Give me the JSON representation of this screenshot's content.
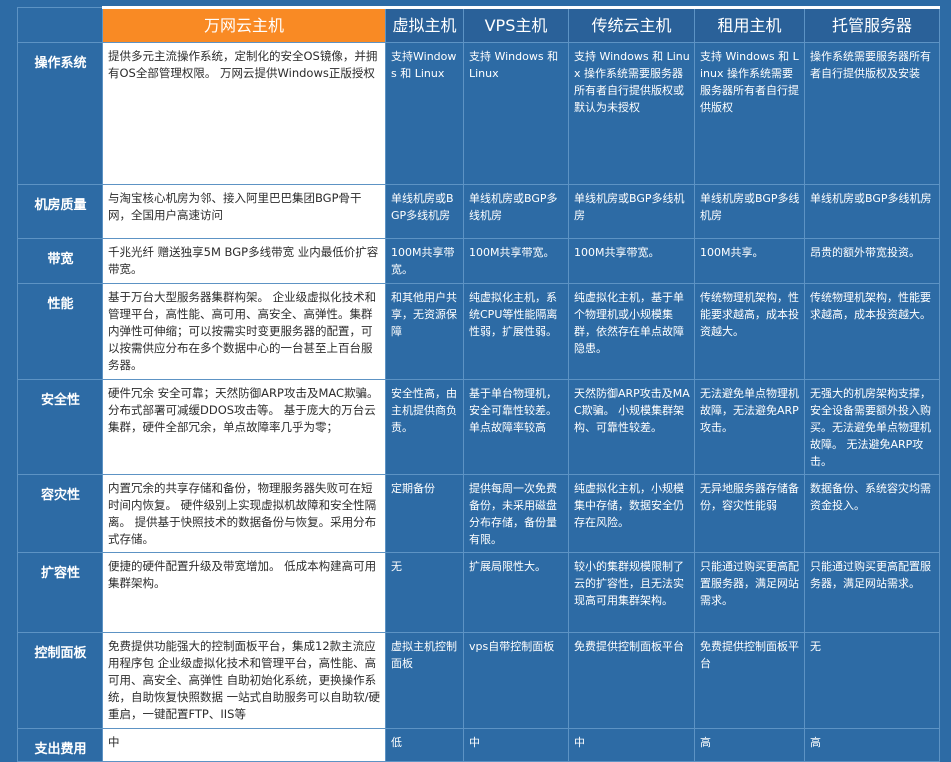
{
  "headers": [
    "",
    "万网云主机",
    "虚拟主机",
    "VPS主机",
    "传统云主机",
    "租用主机",
    "托管服务器"
  ],
  "rows": [
    {
      "label": "操作系统",
      "cells": [
        "提供多元主流操作系统，定制化的安全OS镜像，并拥有OS全部管理权限。 万网云提供Windows正版授权",
        "支持Windows 和 Linux",
        "支持 Windows 和 Linux",
        "支持 Windows 和 Linux 操作系统需要服务器所有者自行提供版权或默认为未授权",
        "支持 Windows 和 Linux 操作系统需要服务器所有者自行提供版权",
        "操作系统需要服务器所有者自行提供版权及安装"
      ]
    },
    {
      "label": "机房质量",
      "cells": [
        "与淘宝核心机房为邻、接入阿里巴巴集团BGP骨干网，全国用户高速访问",
        "单线机房或BGP多线机房",
        "单线机房或BGP多线机房",
        "单线机房或BGP多线机房",
        "单线机房或BGP多线机房",
        "单线机房或BGP多线机房"
      ]
    },
    {
      "label": "带宽",
      "cells": [
        "千兆光纤 赠送独享5M BGP多线带宽 业内最低价扩容带宽。",
        "100M共享带宽。",
        "100M共享带宽。",
        "100M共享带宽。",
        "100M共享。",
        "昂贵的额外带宽投资。"
      ]
    },
    {
      "label": "性能",
      "cells": [
        "基于万台大型服务器集群构架。 企业级虚拟化技术和管理平台，高性能、高可用、高安全、高弹性。集群内弹性可伸缩；可以按需实时变更服务器的配置，可以按需供应分布在多个数据中心的一台甚至上百台服务器。",
        "和其他用户共享，无资源保障",
        "纯虚拟化主机，系统CPU等性能隔离性弱，扩展性弱。",
        "纯虚拟化主机，基于单个物理机或小规模集群，依然存在单点故障隐患。",
        "传统物理机架构，性能要求越高，成本投资越大。",
        "传统物理机架构，性能要求越高，成本投资越大。"
      ]
    },
    {
      "label": "安全性",
      "cells": [
        "硬件冗余 安全可靠；天然防御ARP攻击及MAC欺骗。分布式部署可减缓DDOS攻击等。 基于庞大的万台云集群，硬件全部冗余，单点故障率几乎为零；",
        "安全性高，由主机提供商负责。",
        "基于单台物理机，安全可靠性较差。单点故障率较高",
        "天然防御ARP攻击及MAC欺骗。 小规模集群架构、可靠性较差。",
        "无法避免单点物理机故障，无法避免ARP攻击。",
        "无强大的机房架构支撑，安全设备需要额外投入购买。无法避免单点物理机故障。 无法避免ARP攻击。"
      ]
    },
    {
      "label": "容灾性",
      "cells": [
        "内置冗余的共享存储和备份，物理服务器失败可在短时间内恢复。 硬件级别上实现虚拟机故障和安全性隔离。 提供基于快照技术的数据备份与恢复。采用分布式存储。",
        "定期备份",
        "提供每周一次免费备份，未采用磁盘分布存储，备份量有限。",
        "纯虚拟化主机，小规模集中存储，数据安全仍存在风险。",
        "无异地服务器存储备份，容灾性能弱",
        "数据备份、系统容灾均需资金投入。"
      ]
    },
    {
      "label": "扩容性",
      "cells": [
        "便捷的硬件配置升级及带宽增加。 低成本构建高可用集群架构。",
        "无",
        "扩展局限性大。",
        "较小的集群规模限制了云的扩容性，且无法实现高可用集群架构。",
        "只能通过购买更高配置服务器，满足网站需求。",
        "只能通过购买更高配置服务器，满足网站需求。"
      ]
    },
    {
      "label": "控制面板",
      "cells": [
        "免费提供功能强大的控制面板平台，集成12款主流应用程序包 企业级虚拟化技术和管理平台，高性能、高可用、高安全、高弹性 自助初始化系统，更换操作系统，自助恢复快照数据 一站式自助服务可以自助软/硬重启，一键配置FTP、IIS等",
        "虚拟主机控制面板",
        "vps自带控制面板",
        "免费提供控制面板平台",
        "免费提供控制面板平台",
        "无"
      ]
    },
    {
      "label": "支出费用",
      "cells": [
        "中",
        "低",
        "中",
        "中",
        "高",
        "高"
      ]
    }
  ],
  "colors": {
    "background": "#2d6ba5",
    "highlight_header": "#f98a24",
    "highlight_column": "#ffffff",
    "grid": "#5d93c4"
  }
}
